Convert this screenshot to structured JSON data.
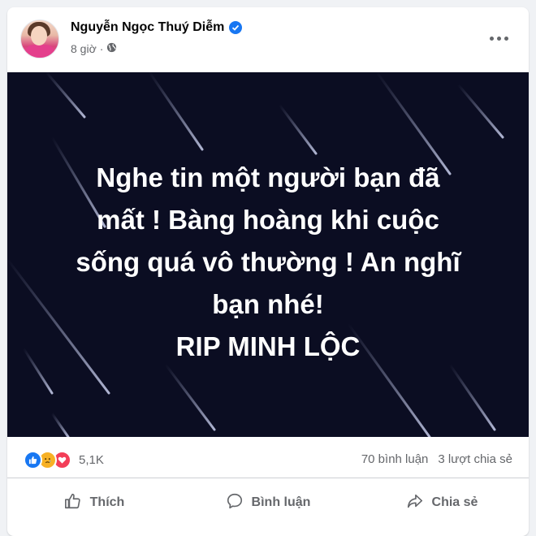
{
  "post": {
    "author": "Nguyễn Ngọc Thuý Diễm",
    "time": "8 giờ",
    "image_lines": [
      "Nghe tin một người bạn đã",
      "mất ! Bàng hoàng khi cuộc",
      "sống quá vô thường ! An nghĩ",
      "bạn nhé!",
      "RIP MINH LỘC"
    ],
    "reactions": {
      "icons": [
        "like-icon",
        "sad-icon",
        "love-icon"
      ],
      "count": "5,1K"
    },
    "comments": "70 bình luận",
    "shares": "3 lượt chia sẻ"
  },
  "actions": {
    "like": "Thích",
    "comment": "Bình luận",
    "share": "Chia sẻ"
  },
  "colors": {
    "brand": "#1877f2",
    "image_bg": "#0b0d22",
    "secondary_text": "#65676b"
  }
}
